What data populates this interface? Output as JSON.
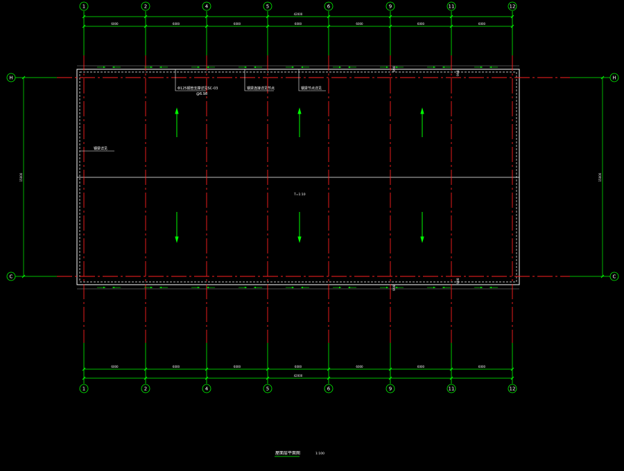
{
  "colors": {
    "background": "#000000",
    "axis_line": "#ff2020",
    "dimension": "#00ff00",
    "outline": "#ffffff",
    "bubble": "#00ff00"
  },
  "drawing": {
    "vertical_axes": [
      "1",
      "2",
      "4",
      "5",
      "6",
      "9",
      "11",
      "12"
    ],
    "horizontal_axes": [
      "H",
      "C"
    ],
    "top_bay_dims": [
      "6000",
      "6000",
      "6000",
      "6000",
      "6000",
      "6000",
      "6000"
    ],
    "top_total_dim": "42000",
    "bottom_bay_dims": [
      "6000",
      "6000",
      "6000",
      "6000",
      "6000",
      "6000",
      "6000"
    ],
    "bottom_total_dim": "42000",
    "left_total_dim": "15000",
    "right_total_dim": "15000",
    "annotations": {
      "note_a_line1": "Φ125钢管支撑详见SC-03",
      "note_a_line2": "@6.98",
      "note_b": "钢梁连接详见节点",
      "note_c": "钢梁节点详见",
      "note_d": "钢梁详见",
      "center_label": "T=1:10",
      "top_mark_right": "998",
      "top_mark_mid": "998",
      "bottom_mark_right": "998",
      "bottom_mark_mid": "998"
    },
    "title": "屋面层平面图",
    "scale": "1:100"
  }
}
